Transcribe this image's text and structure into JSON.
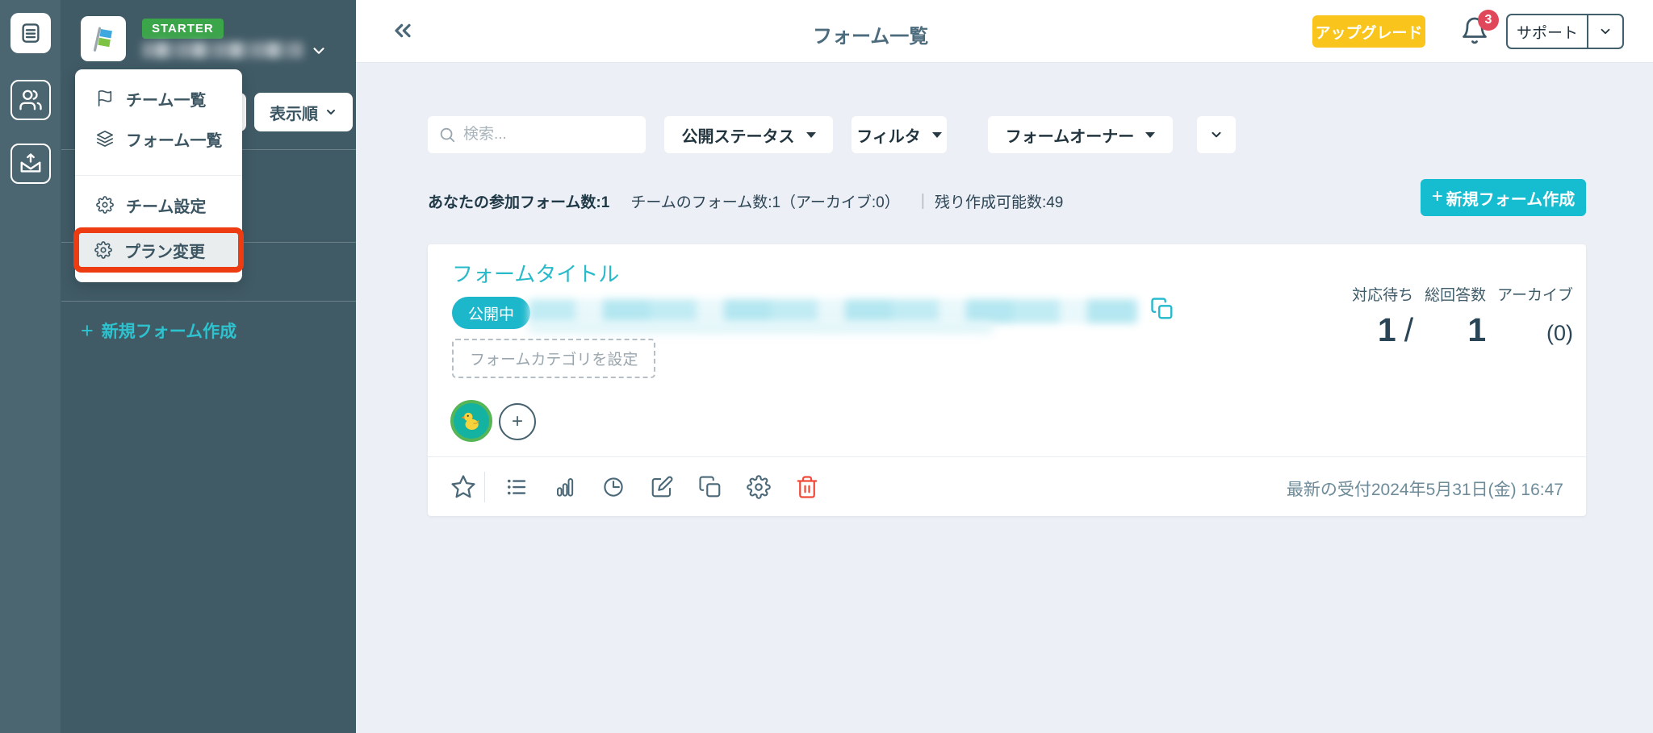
{
  "sidebar": {
    "plan_badge": "STARTER",
    "sort_button_label": "表示順",
    "new_form_link_label": "新規フォーム作成",
    "plus": "+"
  },
  "team_menu": {
    "items": [
      {
        "label": "チーム一覧",
        "icon": "flag-icon"
      },
      {
        "label": "フォーム一覧",
        "icon": "layers-icon"
      },
      {
        "label": "チーム設定",
        "icon": "gear-icon"
      },
      {
        "label": "プラン変更",
        "icon": "gear-icon",
        "highlighted": true
      }
    ]
  },
  "header": {
    "title": "フォーム一覧",
    "upgrade_label": "アップグレード",
    "notification_count": "3",
    "support_label": "サポート"
  },
  "toolbar": {
    "search_placeholder": "検索...",
    "filters": [
      {
        "label": "公開ステータス"
      },
      {
        "label": "フィルタ"
      },
      {
        "label": "フォームオーナー"
      }
    ]
  },
  "stats_bar": {
    "joined_forms": "あなたの参加フォーム数:1",
    "team_forms": "チームのフォーム数:1（アーカイブ:0）",
    "separator": "|",
    "remaining": "残り作成可能数:49",
    "new_form_button_label": "新規フォーム作成",
    "plus": "+"
  },
  "card": {
    "title": "フォームタイトル",
    "status_badge": "公開中",
    "category_button": "フォームカテゴリを設定",
    "pending_label": "対応待ち",
    "pending_value": "1",
    "value_separator": "/",
    "total_label": "総回答数",
    "total_value": "1",
    "archive_label": "アーカイブ",
    "archive_value": "(0)",
    "last_received": "最新の受付2024年5月31日(金) 16:47"
  },
  "colors": {
    "accent_teal": "#1cbccd",
    "sidebar_dark": "#415b66",
    "upgrade_yellow": "#f9c51d",
    "highlight_red": "#ee3c12",
    "danger_red": "#f04a3a",
    "notification_red": "#e0475a",
    "plan_green": "#3ba54a"
  }
}
